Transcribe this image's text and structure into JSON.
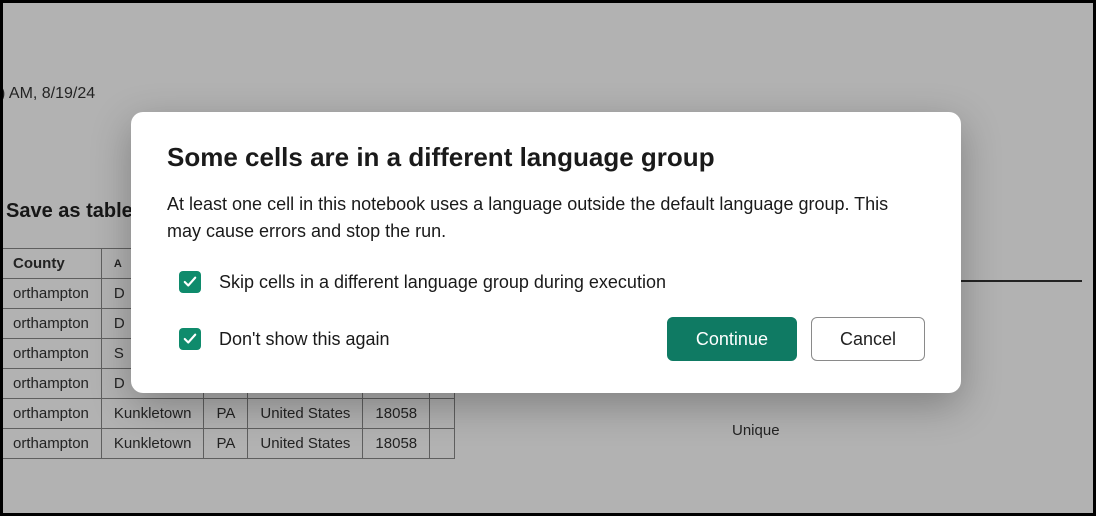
{
  "background": {
    "timestamp": ") AM, 8/19/24",
    "save_as_label": "Save as table",
    "right_label": "Unique",
    "table": {
      "headers": [
        "County",
        "A",
        "",
        "",
        "",
        ""
      ],
      "rows": [
        [
          "orthampton",
          "D",
          "",
          "",
          "",
          ""
        ],
        [
          "orthampton",
          "D",
          "",
          "",
          "",
          ""
        ],
        [
          "orthampton",
          "S",
          "",
          "",
          "",
          ""
        ],
        [
          "orthampton",
          "D",
          "",
          "",
          "",
          ""
        ],
        [
          "orthampton",
          "Kunkletown",
          "PA",
          "United States",
          "18058",
          ""
        ],
        [
          "orthampton",
          "Kunkletown",
          "PA",
          "United States",
          "18058",
          ""
        ]
      ]
    }
  },
  "dialog": {
    "title": "Some cells are in a different language group",
    "body": "At least one cell in this notebook uses a language outside the default language group. This may cause errors and stop the run.",
    "checkbox_skip": {
      "checked": true,
      "label": "Skip cells in a different language group during execution"
    },
    "checkbox_dont_show": {
      "checked": true,
      "label": "Don't show this again"
    },
    "buttons": {
      "continue": "Continue",
      "cancel": "Cancel"
    },
    "colors": {
      "accent": "#0f7a63",
      "checkbox": "#0f8b6c"
    }
  }
}
